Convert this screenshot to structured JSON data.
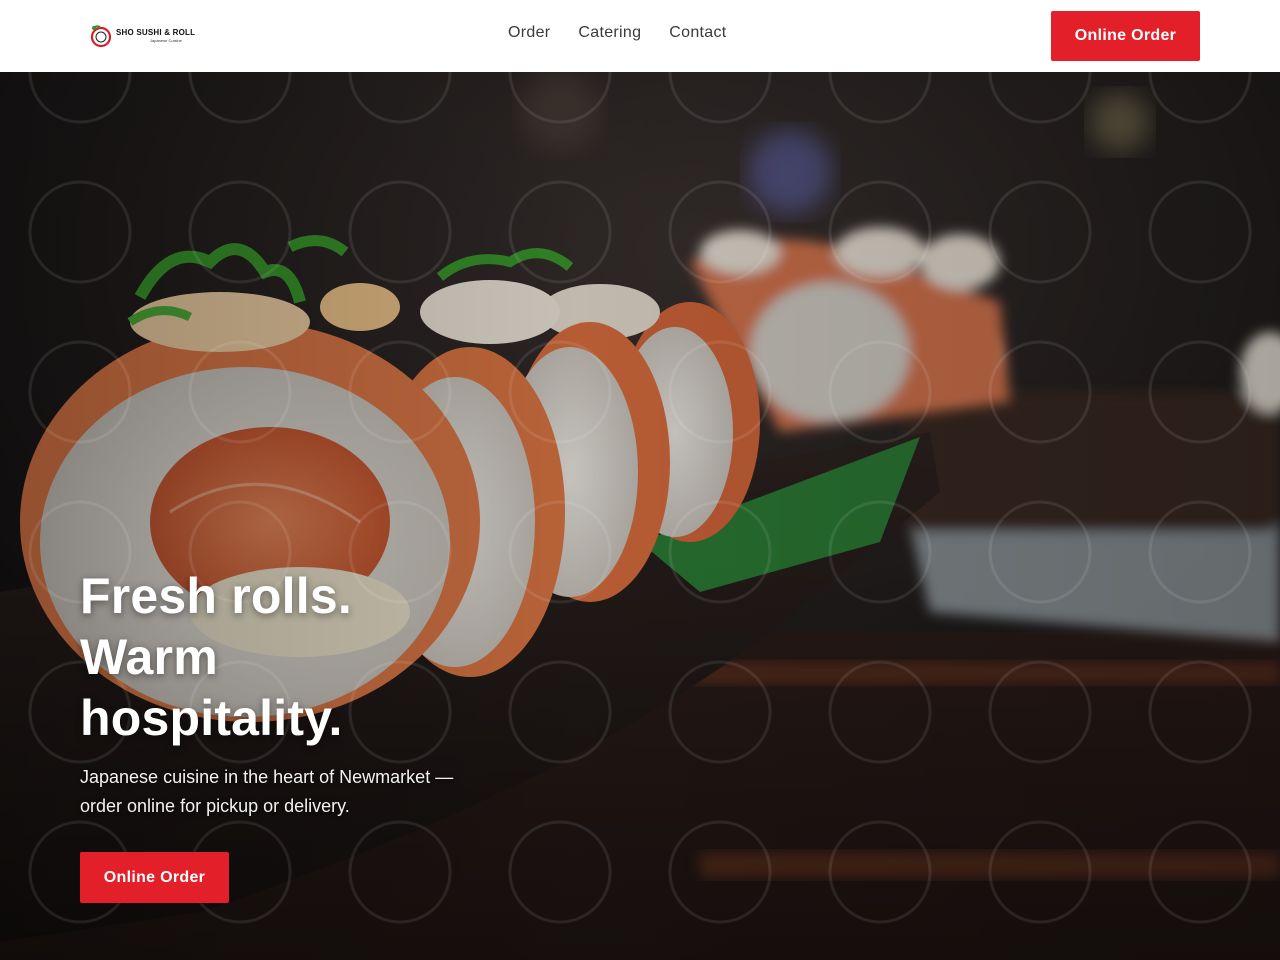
{
  "header": {
    "logo": {
      "name": "SHO SUSHI & ROLL",
      "tagline": "Japanese Cuisine"
    },
    "nav": [
      {
        "label": "Order"
      },
      {
        "label": "Catering"
      },
      {
        "label": "Contact"
      }
    ],
    "cta_label": "Online Order"
  },
  "hero": {
    "headline": [
      "Fresh rolls.",
      "Warm",
      "hospitality."
    ],
    "subtitle": "Japanese cuisine in the heart of Newmarket — order online for pickup or delivery.",
    "cta_label": "Online Order",
    "photo_icon": "sushi-rolls-photo"
  },
  "colors": {
    "accent": "#e3202a",
    "header_bg": "#ffffff",
    "nav_text": "#3a3a3a",
    "hero_text": "#ffffff"
  }
}
